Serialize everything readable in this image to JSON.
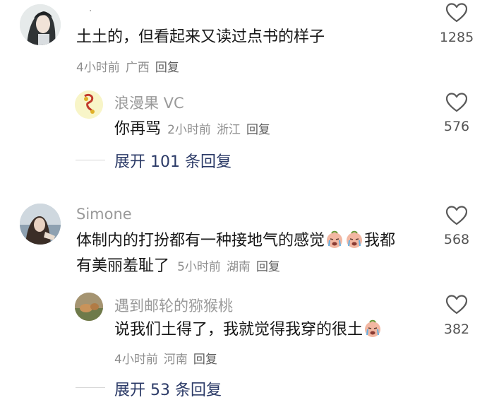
{
  "comments": [
    {
      "username": ".",
      "text": "土土的，但看起来又读过点书的样子",
      "time": "4小时前",
      "location": "广西",
      "reply_label": "回复",
      "likes": "1285",
      "replies": [
        {
          "username": "浪漫果 VC",
          "text": "你再骂",
          "time": "2小时前",
          "location": "浙江",
          "reply_label": "回复",
          "likes": "576"
        }
      ],
      "expand_label": "展开 101 条回复"
    },
    {
      "username": "Simone",
      "text_line1": "体制内的打扮都有一种接地气的感觉",
      "text_line1_after": "我都",
      "text_line2": "有美丽羞耻了",
      "time": "5小时前",
      "location": "湖南",
      "reply_label": "回复",
      "likes": "568",
      "replies": [
        {
          "username": "遇到邮轮的猕猴桃",
          "text": "说我们土得了，我就觉得我穿的很土",
          "time": "4小时前",
          "location": "河南",
          "reply_label": "回复",
          "likes": "382"
        }
      ],
      "expand_label": "展开 53 条回复"
    }
  ],
  "colors": {
    "expand": "#2b3a67",
    "meta": "#8e8e8e",
    "name": "#9a9a9a"
  },
  "icons": {
    "like": "heart-outline-icon",
    "emoji": "crying-face-emoji"
  }
}
